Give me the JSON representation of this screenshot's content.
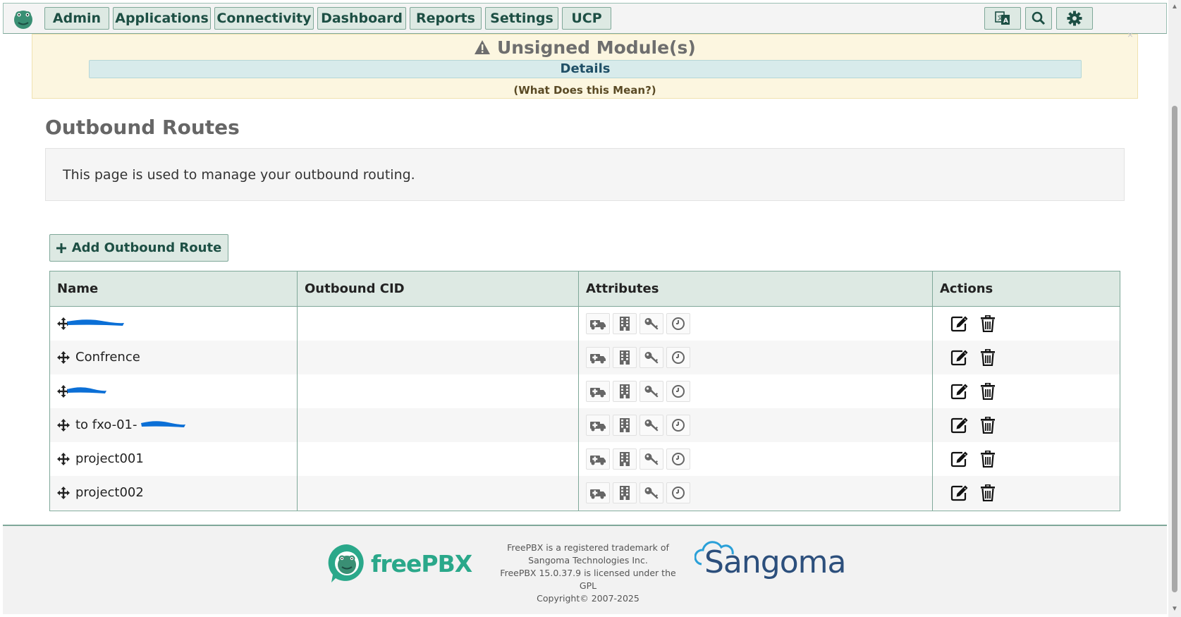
{
  "nav": {
    "items": [
      "Admin",
      "Applications",
      "Connectivity",
      "Dashboard",
      "Reports",
      "Settings",
      "UCP"
    ],
    "icons": [
      "language-icon",
      "search-icon",
      "gear-icon"
    ]
  },
  "alert": {
    "title": "Unsigned Module(s)",
    "details": "Details",
    "what_means": "(What Does this Mean?)",
    "close": "×"
  },
  "page": {
    "title": "Outbound Routes",
    "description": "This page is used to manage your outbound routing.",
    "add_button": "Add Outbound Route"
  },
  "table": {
    "headers": [
      "Name",
      "Outbound CID",
      "Attributes",
      "Actions"
    ],
    "rows": [
      {
        "name": "",
        "redacted": true
      },
      {
        "name": "Confrence",
        "redacted": false
      },
      {
        "name": "",
        "redacted": true
      },
      {
        "name": "to fxo-01-",
        "redacted": true
      },
      {
        "name": "project001",
        "redacted": false
      },
      {
        "name": "project002",
        "redacted": false
      }
    ],
    "attribute_icons": [
      "emergency-icon",
      "intra-company-icon",
      "password-icon",
      "time-group-icon"
    ],
    "action_icons": [
      "edit-icon",
      "delete-icon"
    ]
  },
  "footer": {
    "brand": "freePBX",
    "lines": [
      "FreePBX is a registered trademark of",
      "Sangoma Technologies Inc.",
      "FreePBX 15.0.37.9 is licensed under the",
      "GPL",
      "Copyright© 2007-2025"
    ],
    "sangoma": "Sangoma"
  },
  "colors": {
    "accent": "#7fa899",
    "button_bg": "#dde9e3",
    "button_text": "#1d4f44",
    "alert_bg": "#fcf6e0",
    "brand_green": "#2aa88a",
    "redaction_blue": "#0b6fd6"
  }
}
